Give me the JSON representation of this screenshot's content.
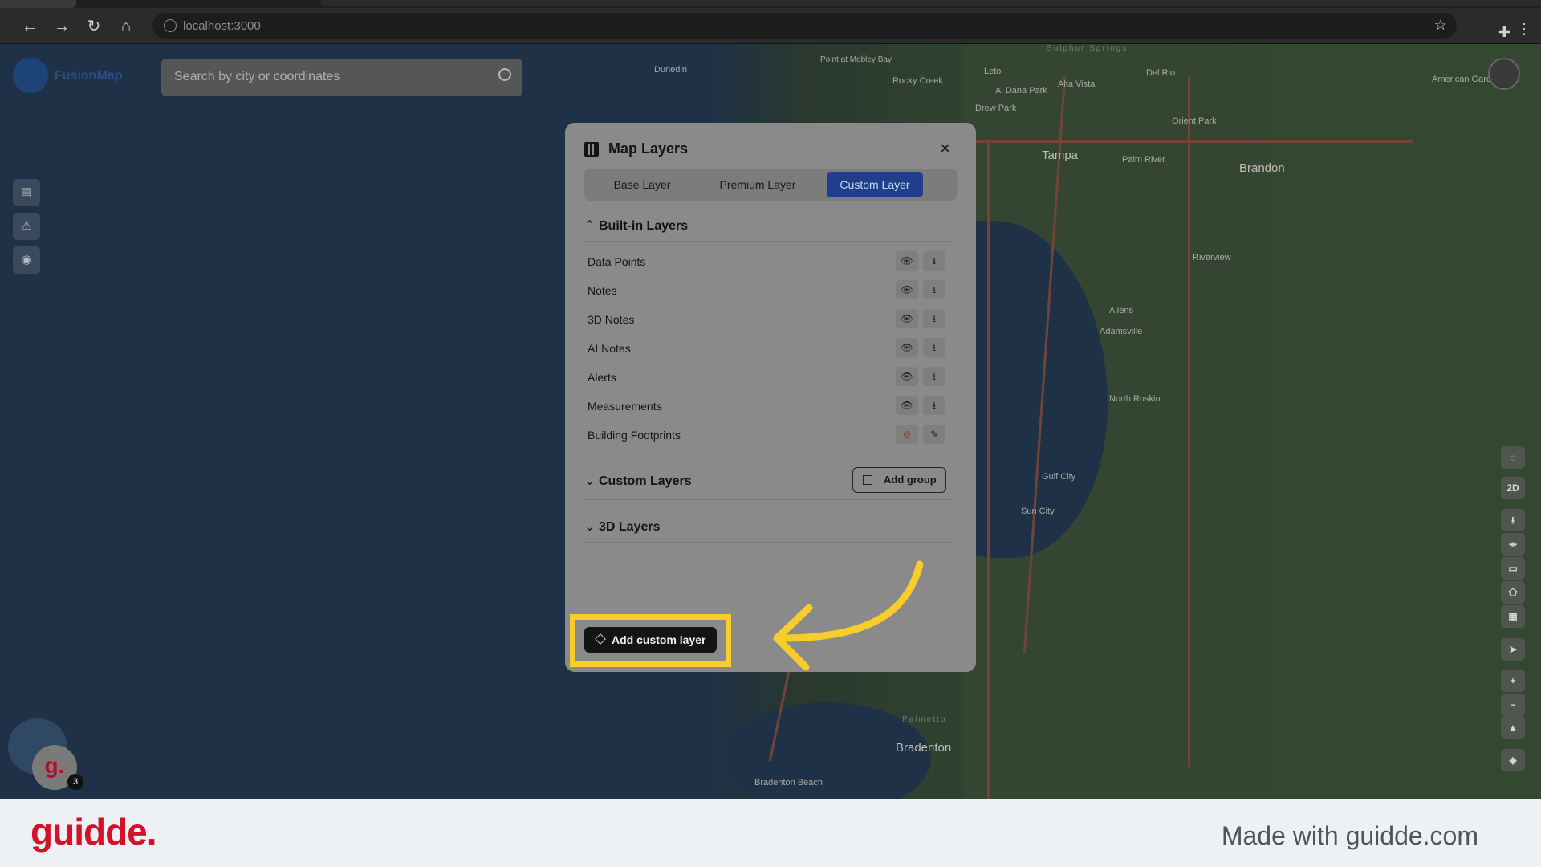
{
  "browser": {
    "url": "localhost:3000"
  },
  "app": {
    "logo_text": "FusionMap",
    "search_placeholder": "Search by city or coordinates"
  },
  "map_labels": [
    {
      "text": "Dunedin"
    },
    {
      "text": "Point at Mobley Bay"
    },
    {
      "text": "Rocky Creek"
    },
    {
      "text": "Leto"
    },
    {
      "text": "Al Dana Park"
    },
    {
      "text": "Drew Park"
    },
    {
      "text": "Tampa"
    },
    {
      "text": "Palm River"
    },
    {
      "text": "Brandon"
    },
    {
      "text": "Orient Park"
    },
    {
      "text": "Del Rio"
    },
    {
      "text": "Alta Vista"
    },
    {
      "text": "Riverview"
    },
    {
      "text": "Allens"
    },
    {
      "text": "Adamsville"
    },
    {
      "text": "North Ruskin"
    },
    {
      "text": "Gulf City"
    },
    {
      "text": "Sun City"
    },
    {
      "text": "Bradenton"
    },
    {
      "text": "Bradenton Beach"
    },
    {
      "text": "American Gardens"
    },
    {
      "text": "Sulphur Springs"
    },
    {
      "text": "Palmetto"
    }
  ],
  "modal": {
    "title": "Map Layers",
    "close_label": "×",
    "tabs": [
      {
        "label": "Base Layer"
      },
      {
        "label": "Premium Layer"
      },
      {
        "label": "Custom Layer",
        "active": true
      }
    ],
    "builtin_header": "Built-in Layers",
    "builtin_layers": [
      {
        "name": "Data Points",
        "visible": true
      },
      {
        "name": "Notes",
        "visible": true
      },
      {
        "name": "3D Notes",
        "visible": true
      },
      {
        "name": "AI Notes",
        "visible": true
      },
      {
        "name": "Alerts",
        "visible": true
      },
      {
        "name": "Measurements",
        "visible": true
      },
      {
        "name": "Building Footprints",
        "visible": false
      }
    ],
    "custom_header": "Custom Layers",
    "add_group_label": "Add group",
    "threed_header": "3D Layers",
    "add_custom_label": "Add custom layer"
  },
  "right_toolbar": {
    "mode_label": "2D"
  },
  "guidde": {
    "avatar_letter": "g.",
    "badge_count": "3",
    "brand": "guidde.",
    "made_with": "Made with guidde.com"
  },
  "colors": {
    "accent_tab": "#1f3f8a",
    "highlight": "#f7cc2b",
    "brand_red": "#d3112b"
  }
}
